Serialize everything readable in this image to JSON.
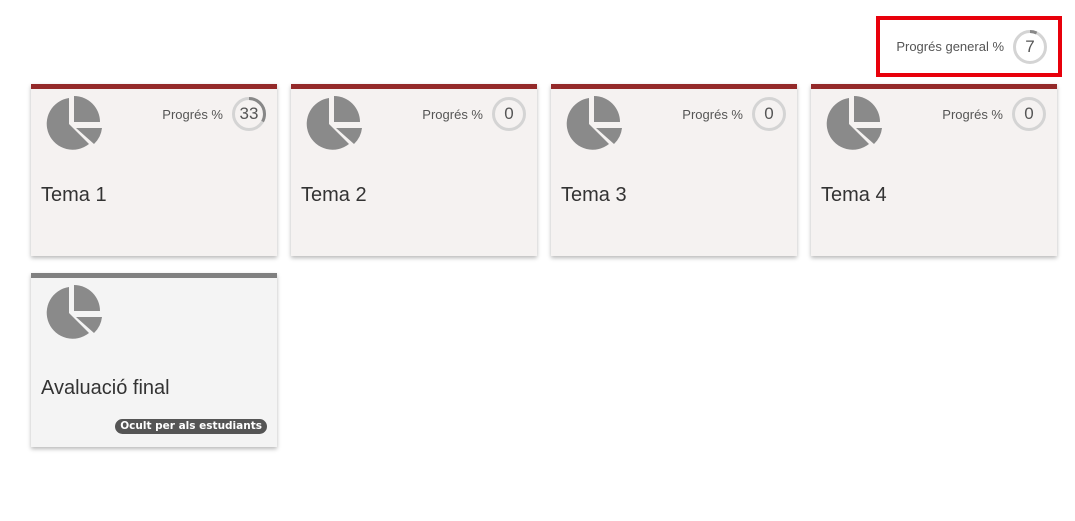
{
  "overall": {
    "label": "Progrés general %",
    "value": "7",
    "fraction": 0.07
  },
  "colors": {
    "accent": "#942a2a",
    "hidden_bar": "#808080",
    "ring_track": "#d4d4d4",
    "ring_fill": "#888888",
    "highlight": "#e8000b"
  },
  "tiles": [
    {
      "title": "Tema 1",
      "progress_label": "Progrés %",
      "progress": "33",
      "fraction": 0.33,
      "icon": "pie-chart-icon"
    },
    {
      "title": "Tema 2",
      "progress_label": "Progrés %",
      "progress": "0",
      "fraction": 0,
      "icon": "pie-chart-icon"
    },
    {
      "title": "Tema 3",
      "progress_label": "Progrés %",
      "progress": "0",
      "fraction": 0,
      "icon": "pie-chart-icon"
    },
    {
      "title": "Tema 4",
      "progress_label": "Progrés %",
      "progress": "0",
      "fraction": 0,
      "icon": "pie-chart-icon"
    },
    {
      "title": "Avaluació final",
      "badge": "Ocult per als estudiants",
      "icon": "pie-chart-icon"
    }
  ]
}
